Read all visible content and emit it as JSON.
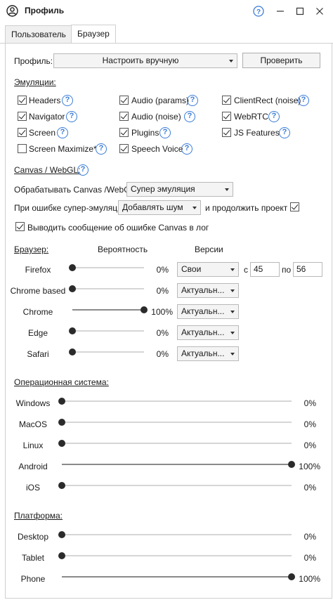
{
  "window": {
    "title": "Профиль",
    "icon": "user-circle-icon"
  },
  "tabs": [
    {
      "label": "Пользователь",
      "active": false
    },
    {
      "label": "Браузер",
      "active": true
    }
  ],
  "profile": {
    "label": "Профиль:",
    "value": "Настроить вручную",
    "check_button": "Проверить"
  },
  "emulations": {
    "title": "Эмуляции:",
    "items": [
      {
        "label": "Headers",
        "checked": true
      },
      {
        "label": "Audio (params)",
        "checked": true
      },
      {
        "label": "ClientRect (noise)",
        "checked": true
      },
      {
        "label": "Navigator",
        "checked": true
      },
      {
        "label": "Audio (noise)",
        "checked": true
      },
      {
        "label": "WebRTC",
        "checked": true
      },
      {
        "label": "Screen",
        "checked": true
      },
      {
        "label": "Plugins",
        "checked": true
      },
      {
        "label": "JS Features",
        "checked": true
      },
      {
        "label": "Screen Maximize*",
        "checked": false
      },
      {
        "label": "Speech Voice",
        "checked": true
      }
    ]
  },
  "canvas": {
    "title": "Canvas / WebGL:",
    "process_label": "Обрабатывать Canvas /WebGL",
    "process_value": "Супер эмуляция",
    "on_error_label": "При ошибке супер-эмуляции",
    "on_error_value": "Добавлять шум",
    "continue_label": "и продолжить проект",
    "continue_checked": true,
    "log_label": "Выводить сообщение об ошибке Canvas в лог",
    "log_checked": true
  },
  "browser": {
    "title": "Браузер:",
    "col_probability": "Вероятность",
    "col_versions": "Версии",
    "from_label": "с",
    "to_label": "по",
    "rows": [
      {
        "name": "Firefox",
        "fraction": 0.0,
        "percent": "0%",
        "version": "Свои",
        "from": "45",
        "to": "56"
      },
      {
        "name": "Chrome based",
        "fraction": 0.0,
        "percent": "0%",
        "version": "Актуальн..."
      },
      {
        "name": "Chrome",
        "fraction": 1.0,
        "percent": "100%",
        "version": "Актуальн..."
      },
      {
        "name": "Edge",
        "fraction": 0.0,
        "percent": "0%",
        "version": "Актуальн..."
      },
      {
        "name": "Safari",
        "fraction": 0.0,
        "percent": "0%",
        "version": "Актуальн..."
      }
    ]
  },
  "os": {
    "title": "Операционная система:",
    "rows": [
      {
        "name": "Windows",
        "fraction": 0.0,
        "percent": "0%"
      },
      {
        "name": "MacOS",
        "fraction": 0.0,
        "percent": "0%"
      },
      {
        "name": "Linux",
        "fraction": 0.0,
        "percent": "0%"
      },
      {
        "name": "Android",
        "fraction": 1.0,
        "percent": "100%"
      },
      {
        "name": "iOS",
        "fraction": 0.0,
        "percent": "0%"
      }
    ]
  },
  "platform": {
    "title": "Платформа:",
    "rows": [
      {
        "name": "Desktop",
        "fraction": 0.0,
        "percent": "0%"
      },
      {
        "name": "Tablet",
        "fraction": 0.0,
        "percent": "0%"
      },
      {
        "name": "Phone",
        "fraction": 1.0,
        "percent": "100%"
      }
    ]
  },
  "colors": {
    "accent": "#3b7dd8",
    "thumb": "#2b2b2b",
    "track": "#d6d6d6"
  }
}
